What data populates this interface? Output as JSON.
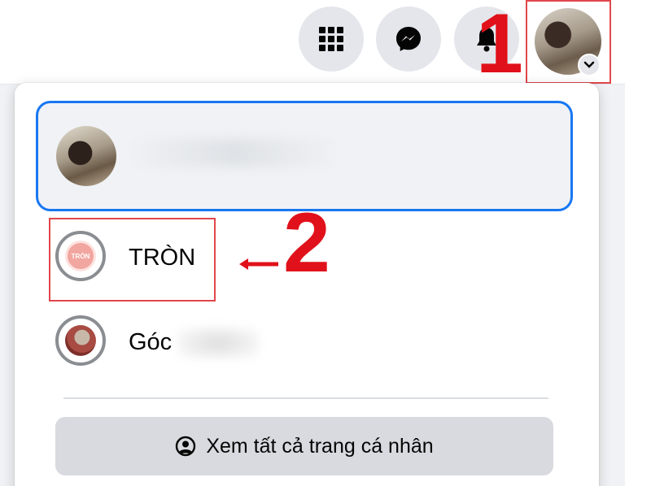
{
  "header": {
    "menu_icon": "grid-menu-icon",
    "messenger_icon": "messenger-icon",
    "notification_icon": "bell-icon",
    "account_icon": "chevron-down-icon"
  },
  "annotations": {
    "step_1": "1",
    "step_2": "2"
  },
  "dropdown": {
    "pages": [
      {
        "label": "TRÒN",
        "icon_text": "TRÒN"
      },
      {
        "label": "Góc"
      }
    ],
    "see_all_label": "Xem tất cả trang cá nhân",
    "see_all_icon": "switch-profile-icon"
  },
  "colors": {
    "accent": "#1877f2",
    "highlight_box": "#e0474c",
    "annotation_red": "#e0111a"
  }
}
